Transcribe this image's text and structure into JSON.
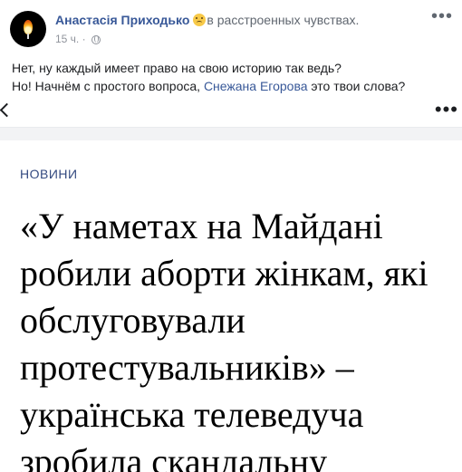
{
  "post": {
    "author": "Анастасія Приходько",
    "feeling": "в расстроенных чувствах.",
    "feeling_icon": "sad-face-emoji",
    "time": "15 ч.",
    "separator": "·",
    "audience_icon": "globe-icon",
    "more_label": "•••",
    "line1": "Нет, ну каждый имеет право на свою историю так ведь?",
    "line2_before": "Но! Начнём с простого вопроса, ",
    "mention": "Снежана Егорова",
    "line2_after": " это твои слова?"
  },
  "link_bar": {
    "back_icon": "chevron-left-icon",
    "more_label": "•••"
  },
  "article": {
    "category": "НОВИНИ",
    "headline": "«У наметах на Майдані робили аборти жінкам, які обслуговували протестувальників» – українська телеведуча зробила скандальну"
  },
  "colors": {
    "link": "#385898",
    "category": "#344a80",
    "muted": "#90949c"
  }
}
